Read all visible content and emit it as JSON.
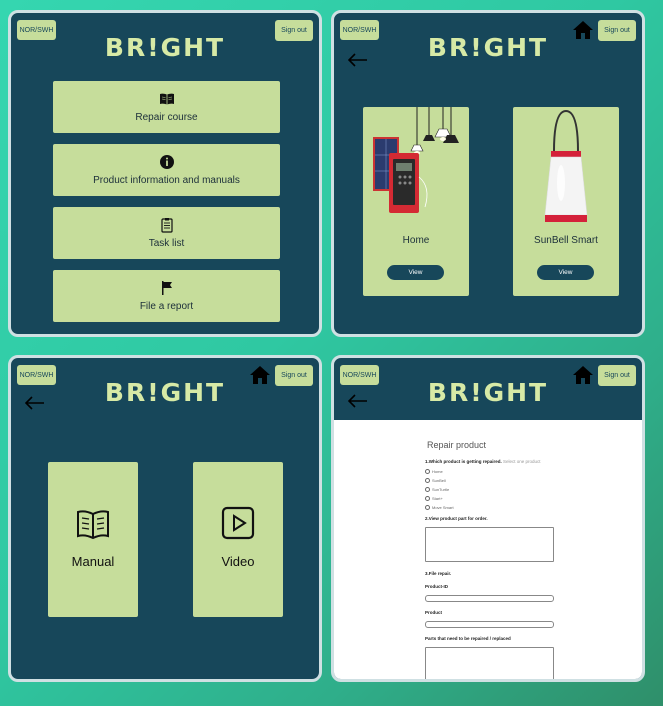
{
  "brand": "BR!GHT",
  "header": {
    "lang_label": "NOR/SWH",
    "signout_label": "Sign out"
  },
  "menu": {
    "items": [
      {
        "label": "Repair course",
        "icon": "book-icon"
      },
      {
        "label": "Product information and manuals",
        "icon": "info-icon"
      },
      {
        "label": "Task list",
        "icon": "clipboard-icon"
      },
      {
        "label": "File a report",
        "icon": "flag-icon"
      }
    ]
  },
  "products": {
    "items": [
      {
        "name": "Home",
        "view_label": "View"
      },
      {
        "name": "SunBell Smart",
        "view_label": "View"
      }
    ]
  },
  "resources": {
    "items": [
      {
        "label": "Manual",
        "icon": "book-open-icon"
      },
      {
        "label": "Video",
        "icon": "play-icon"
      }
    ]
  },
  "form": {
    "title": "Repair product",
    "q1": "1.Which product is getting repaired.",
    "q1_hint": "Select one product",
    "options": [
      "Home",
      "SunBell",
      "SunTurtle",
      "Start+",
      "Move Smart"
    ],
    "q2": "2.View product part for order.",
    "q3": "3.File repair.",
    "field_product_id": "Product-ID",
    "field_product": "Product",
    "field_parts": "Parts that need to be repaired / replaced"
  },
  "colors": {
    "panel_bg": "#17475a",
    "accent": "#c6dd9b",
    "brand_text": "#d7eaa6"
  }
}
